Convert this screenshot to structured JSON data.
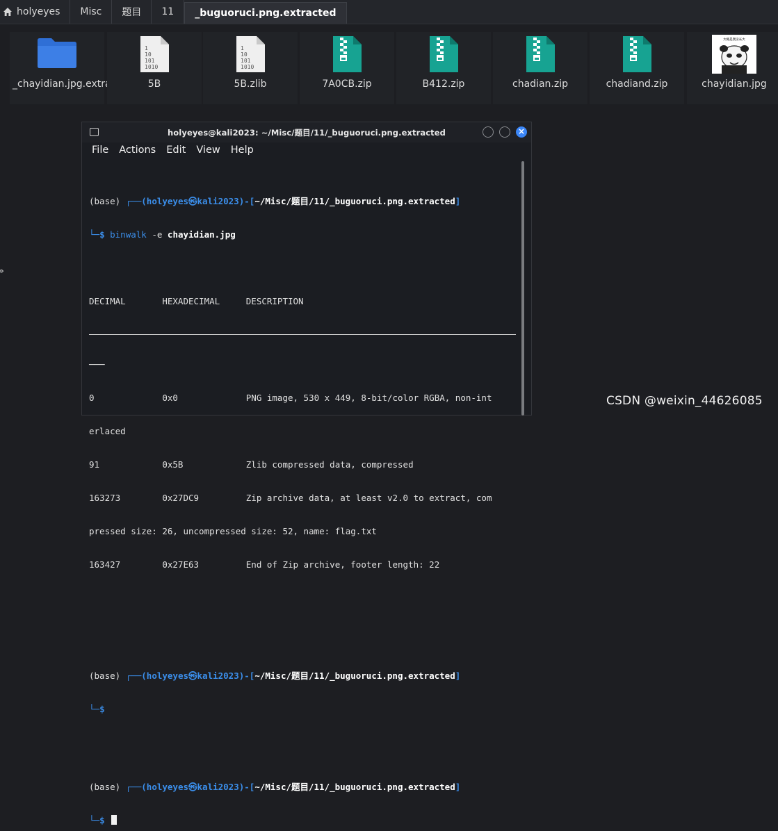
{
  "breadcrumb": [
    {
      "label": "holyeyes",
      "icon": "home-icon"
    },
    {
      "label": "Misc"
    },
    {
      "label": "题目"
    },
    {
      "label": "11"
    },
    {
      "label": "_buguoruci.png.extracted",
      "active": true
    }
  ],
  "files": [
    {
      "name": "_chayidian.jpg.extracted",
      "type": "folder"
    },
    {
      "name": "5B",
      "type": "binary"
    },
    {
      "name": "5B.zlib",
      "type": "binary"
    },
    {
      "name": "7A0CB.zip",
      "type": "zip"
    },
    {
      "name": "B412.zip",
      "type": "zip"
    },
    {
      "name": "chadian.zip",
      "type": "zip"
    },
    {
      "name": "chadiand.zip",
      "type": "zip"
    },
    {
      "name": "chayidian.jpg",
      "type": "image",
      "thumb_caption": "大概是我没长大"
    }
  ],
  "terminal": {
    "title": "holyeyes@kali2023: ~/Misc/题目/11/_buguoruci.png.extracted",
    "menu": [
      "File",
      "Actions",
      "Edit",
      "View",
      "Help"
    ],
    "prompt": {
      "env": "(base) ",
      "box_top": "┌──(",
      "user": "holyeyes",
      "at": "㉿",
      "host": "kali2023",
      "close_paren": ")-[",
      "cwd": "~/Misc/题目/11/_buguoruci.png.extracted",
      "close_bracket": "]",
      "box_bottom": "└─",
      "dollar": "$"
    },
    "command_name": "binwalk",
    "command_flag": " -e ",
    "command_arg": "chayidian.jpg",
    "headers": "DECIMAL       HEXADECIMAL     DESCRIPTION",
    "rule_tail": "───",
    "output": [
      "0             0x0             PNG image, 530 x 449, 8-bit/color RGBA, non-int",
      "erlaced",
      "91            0x5B            Zlib compressed data, compressed",
      "163273        0x27DC9         Zip archive data, at least v2.0 to extract, com",
      "pressed size: 26, uncompressed size: 52, name: flag.txt",
      "163427        0x27E63         End of Zip archive, footer length: 22"
    ]
  },
  "watermark": "CSDN @weixin_44626085",
  "edge_glyph": "»",
  "colors": {
    "accent": "#3b8eea",
    "close_button": "#3b86f7",
    "folder": "#3d7fe6",
    "zip": "#17a392"
  }
}
